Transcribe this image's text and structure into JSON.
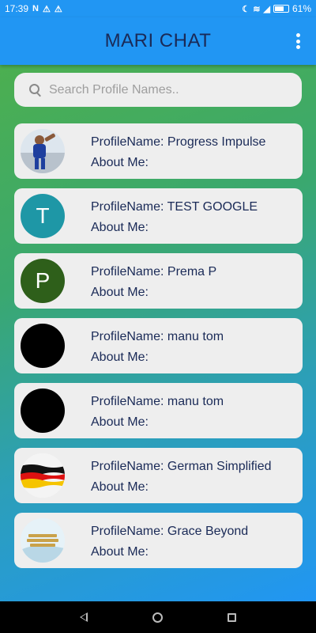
{
  "status_bar": {
    "time": "17:39",
    "battery": "61%"
  },
  "app_bar": {
    "title": "MARI CHAT"
  },
  "search": {
    "placeholder": "Search Profile Names.."
  },
  "profiles": [
    {
      "name_line": "ProfileName: Progress Impulse",
      "about_line": "About Me:",
      "avatar_letter": ""
    },
    {
      "name_line": "ProfileName: TEST GOOGLE",
      "about_line": "About Me:",
      "avatar_letter": "T"
    },
    {
      "name_line": "ProfileName: Prema P",
      "about_line": "About Me:",
      "avatar_letter": "P"
    },
    {
      "name_line": "ProfileName: manu tom",
      "about_line": "About Me:",
      "avatar_letter": ""
    },
    {
      "name_line": "ProfileName: manu tom",
      "about_line": "About Me:",
      "avatar_letter": ""
    },
    {
      "name_line": "ProfileName: German Simplified",
      "about_line": "About Me:",
      "avatar_letter": ""
    },
    {
      "name_line": "ProfileName: Grace Beyond",
      "about_line": "About Me:",
      "avatar_letter": ""
    }
  ],
  "colors": {
    "app_bar": "#2196f3",
    "title_text": "#1a2a57",
    "card": "#eeeeee",
    "avatar_teal": "#1e97a6",
    "avatar_green": "#2e5f1a"
  }
}
